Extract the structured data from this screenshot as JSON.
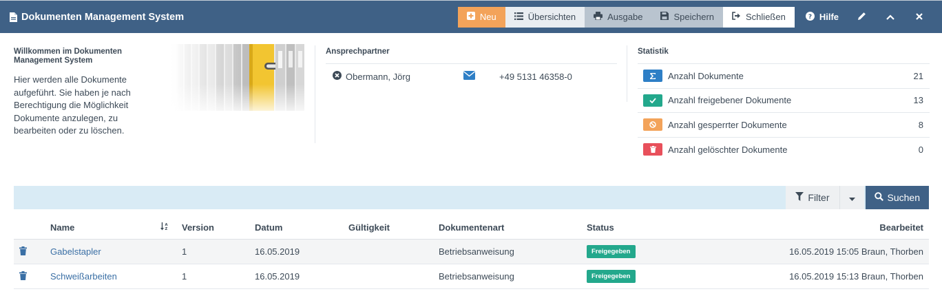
{
  "header": {
    "title": "Dokumenten Management System",
    "toolbar": {
      "neu": "Neu",
      "uebersichten": "Übersichten",
      "ausgabe": "Ausgabe",
      "speichern": "Speichern",
      "schliessen": "Schließen"
    },
    "hilfe": "Hilfe"
  },
  "welcome": {
    "title": "Willkommen im Dokumenten Management System",
    "text": "Hier werden alle Dokumente aufgeführt. Sie haben je nach Berechtigung die Möglichkeit Dokumente anzulegen, zu bearbeiten oder zu löschen."
  },
  "contact": {
    "heading": "Ansprechpartner",
    "name": "Obermann, Jörg",
    "phone": "+49 5131 46358-0"
  },
  "stats": {
    "heading": "Statistik",
    "items": [
      {
        "label": "Anzahl Dokumente",
        "value": "21",
        "color": "#2e7fc6",
        "icon": "sigma-icon"
      },
      {
        "label": "Anzahl freigebener Dokumente",
        "value": "13",
        "color": "#23a88c",
        "icon": "check-icon"
      },
      {
        "label": "Anzahl gesperrter Dokumente",
        "value": "8",
        "color": "#f3a35a",
        "icon": "ban-icon"
      },
      {
        "label": "Anzahl gelöschter Dokumente",
        "value": "0",
        "color": "#e8505b",
        "icon": "trash-icon"
      }
    ]
  },
  "searchbar": {
    "filter": "Filter",
    "suchen": "Suchen"
  },
  "table": {
    "columns": {
      "name": "Name",
      "version": "Version",
      "datum": "Datum",
      "gueltigkeit": "Gültigkeit",
      "dokumentenart": "Dokumentenart",
      "status": "Status",
      "bearbeitet": "Bearbeitet"
    },
    "rows": [
      {
        "name": "Gabelstapler",
        "version": "1",
        "datum": "16.05.2019",
        "gueltigkeit": "",
        "dokumentenart": "Betriebsanweisung",
        "status": "Freigegeben",
        "bearbeitet": "16.05.2019 15:05 Braun, Thorben"
      },
      {
        "name": "Schweißarbeiten",
        "version": "1",
        "datum": "16.05.2019",
        "gueltigkeit": "",
        "dokumentenart": "Betriebsanweisung",
        "status": "Freigegeben",
        "bearbeitet": "16.05.2019 15:13 Braun, Thorben"
      }
    ]
  },
  "colors": {
    "header_bg": "#3f6186",
    "accent_orange": "#f3a35a",
    "status_green": "#23a88c",
    "link_blue": "#3a6fa5"
  }
}
